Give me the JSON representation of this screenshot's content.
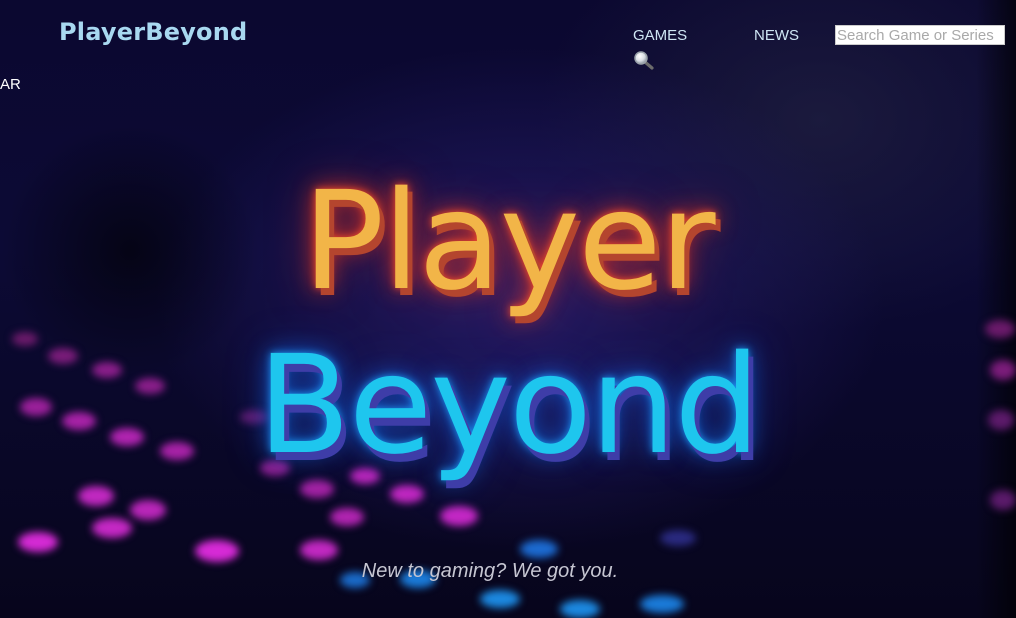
{
  "header": {
    "brand": "PlayerBeyond",
    "nav": {
      "games_label": "GAMES",
      "news_label": "NEWS",
      "overflow_label": "AR"
    },
    "search": {
      "placeholder": "Search Game or Series",
      "value": "",
      "icon": "magnifying-glass-icon"
    }
  },
  "hero": {
    "title_line1": "Player",
    "title_line2": "Beyond",
    "tagline": "New to gaming? We got you."
  },
  "colors": {
    "brand_text": "#a8d8f0",
    "player_orange": "#f2b548",
    "player_glow": "#ff4a2a",
    "beyond_cyan": "#1ec6ee",
    "beyond_shadow": "#3e3da8",
    "key_magenta": "#d62ad6",
    "key_cyan": "#22a8ff",
    "background": "#0b0830"
  }
}
